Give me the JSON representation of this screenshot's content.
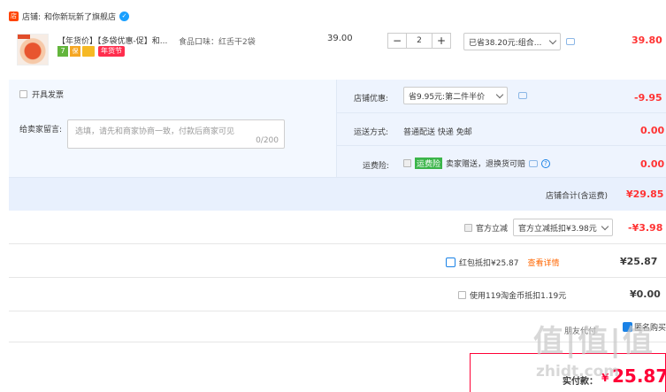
{
  "shop": {
    "label": "店铺:",
    "name": "和你新玩新了旗舰店",
    "icon": "shop-icon",
    "chat_icon": "wangwang-icon"
  },
  "item": {
    "title": "【年货价】【多袋优惠-促】和...",
    "badges": [
      "7",
      "保",
      "",
      "年货节"
    ],
    "flavor": "食品口味：红舌干2袋",
    "unit_price": "39.00",
    "quantity": "2",
    "qty_minus": "−",
    "qty_plus": "+",
    "discount_select": "已省38.20元:组合...",
    "total": "39.80"
  },
  "options": {
    "invoice_label": "开具发票",
    "remark_label": "给卖家留言:",
    "remark_placeholder": "选填，请先和商家协商一致，付款后商家可见",
    "remark_count": "0/200"
  },
  "shop_discount": {
    "label": "店铺优惠:",
    "select": "省9.95元:第二件半价",
    "amount": "-9.95"
  },
  "shipping": {
    "label": "运送方式:",
    "value": "普通配送 快递 免邮",
    "amount": "0.00"
  },
  "freight_insurance": {
    "label": "运费险:",
    "badge": "运费险",
    "value": "卖家赠送，退换货可赔",
    "amount": "0.00"
  },
  "shop_total": {
    "label": "店铺合计(含运费)",
    "amount": "¥29.85"
  },
  "official_discount": {
    "label": "官方立减",
    "select": "官方立减抵扣¥3.98元",
    "amount": "-¥3.98"
  },
  "red_packet": {
    "label": "红包抵扣¥25.87",
    "link": "查看详情",
    "amount": "¥25.87"
  },
  "coins": {
    "label": "使用119淘金币抵扣1.19元",
    "amount": "¥0.00"
  },
  "friend_pay": {
    "label": "朋友代付",
    "anon": "匿名购买"
  },
  "checkout": {
    "label": "实付款：",
    "currency": "¥",
    "amount": "25.87"
  },
  "watermark": {
    "brand": "值|值|值",
    "domain": "zhidt.com"
  },
  "colors": {
    "price_red": "#ff3333",
    "accent_blue": "#1a82e6",
    "panel_blue": "#eef4fe",
    "checkout_border": "#ff0036"
  }
}
